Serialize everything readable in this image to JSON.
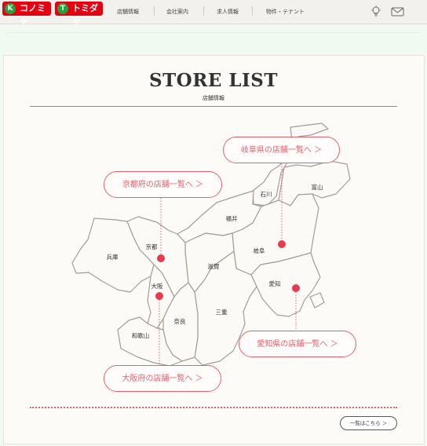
{
  "header": {
    "logos": [
      "コノミヤ",
      "トミダヤ"
    ],
    "logo_marks": [
      "K",
      "T"
    ],
    "nav": [
      "店舗情報",
      "会社案内",
      "求人情報",
      "物件・テナント"
    ],
    "icons": [
      "lightbulb-icon",
      "mail-icon"
    ]
  },
  "section": {
    "title": "STORE LIST",
    "subtitle": "店舗情報"
  },
  "map": {
    "prefectures": [
      "石川",
      "富山",
      "福井",
      "岐阜",
      "京都",
      "兵庫",
      "滋賀",
      "愛知",
      "大阪",
      "三重",
      "奈良",
      "和歌山"
    ]
  },
  "links": {
    "gifu": "岐阜県の店舗一覧へ ＞",
    "kyoto": "京都府の店舗一覧へ ＞",
    "aichi": "愛知県の店舗一覧へ ＞",
    "osaka": "大阪府の店舗一覧へ ＞"
  },
  "more_button": "一覧はこちら ＞",
  "colors": {
    "accent": "#e8606b",
    "brand_red": "#e60012",
    "page_bg": "#f1faf0"
  }
}
